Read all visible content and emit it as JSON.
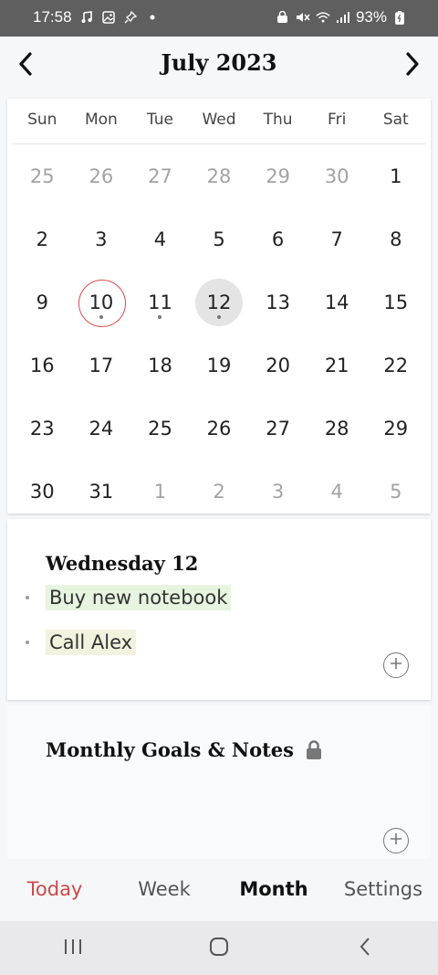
{
  "status_bar": {
    "time": "17:58",
    "battery": "93%",
    "icons_left": [
      "music-icon",
      "image-icon",
      "pin-icon",
      "dot-icon"
    ],
    "icons_right": [
      "lock-badge-icon",
      "mute-icon",
      "wifi-icon",
      "signal-icon",
      "battery-icon"
    ]
  },
  "header": {
    "title": "July 2023",
    "prev_icon": "chevron-left-icon",
    "next_icon": "chevron-right-icon"
  },
  "calendar": {
    "weekdays": [
      "Sun",
      "Mon",
      "Tue",
      "Wed",
      "Thu",
      "Fri",
      "Sat"
    ],
    "weeks": [
      [
        {
          "d": "25",
          "muted": true
        },
        {
          "d": "26",
          "muted": true
        },
        {
          "d": "27",
          "muted": true
        },
        {
          "d": "28",
          "muted": true
        },
        {
          "d": "29",
          "muted": true
        },
        {
          "d": "30",
          "muted": true
        },
        {
          "d": "1"
        }
      ],
      [
        {
          "d": "2"
        },
        {
          "d": "3"
        },
        {
          "d": "4"
        },
        {
          "d": "5"
        },
        {
          "d": "6"
        },
        {
          "d": "7"
        },
        {
          "d": "8"
        }
      ],
      [
        {
          "d": "9"
        },
        {
          "d": "10",
          "today": true,
          "dot": true
        },
        {
          "d": "11",
          "dot": true
        },
        {
          "d": "12",
          "selected": true,
          "dot": true
        },
        {
          "d": "13"
        },
        {
          "d": "14"
        },
        {
          "d": "15"
        }
      ],
      [
        {
          "d": "16"
        },
        {
          "d": "17"
        },
        {
          "d": "18"
        },
        {
          "d": "19"
        },
        {
          "d": "20"
        },
        {
          "d": "21"
        },
        {
          "d": "22"
        }
      ],
      [
        {
          "d": "23"
        },
        {
          "d": "24"
        },
        {
          "d": "25"
        },
        {
          "d": "26"
        },
        {
          "d": "27"
        },
        {
          "d": "28"
        },
        {
          "d": "29"
        }
      ],
      [
        {
          "d": "30"
        },
        {
          "d": "31"
        },
        {
          "d": "1",
          "muted": true
        },
        {
          "d": "2",
          "muted": true
        },
        {
          "d": "3",
          "muted": true
        },
        {
          "d": "4",
          "muted": true
        },
        {
          "d": "5",
          "muted": true
        }
      ]
    ],
    "colors": {
      "today_ring": "#d84a4a",
      "selected_fill": "#e4e4e4"
    }
  },
  "day_panel": {
    "title": "Wednesday 12",
    "tasks": [
      {
        "label": "Buy new notebook",
        "highlight": "#e6f4e0"
      },
      {
        "label": "Call Alex",
        "highlight": "#f1f3df"
      }
    ],
    "add_icon": "plus-circle-icon"
  },
  "notes_panel": {
    "title": "Monthly Goals & Notes",
    "lock_icon": "lock-icon",
    "add_icon": "plus-circle-icon"
  },
  "tabs": [
    {
      "label": "Today",
      "color": "#c94a4a"
    },
    {
      "label": "Week"
    },
    {
      "label": "Month",
      "active": true
    },
    {
      "label": "Settings"
    }
  ],
  "system_nav": {
    "recents_icon": "recents-icon",
    "home_icon": "home-icon",
    "back_icon": "back-icon"
  }
}
